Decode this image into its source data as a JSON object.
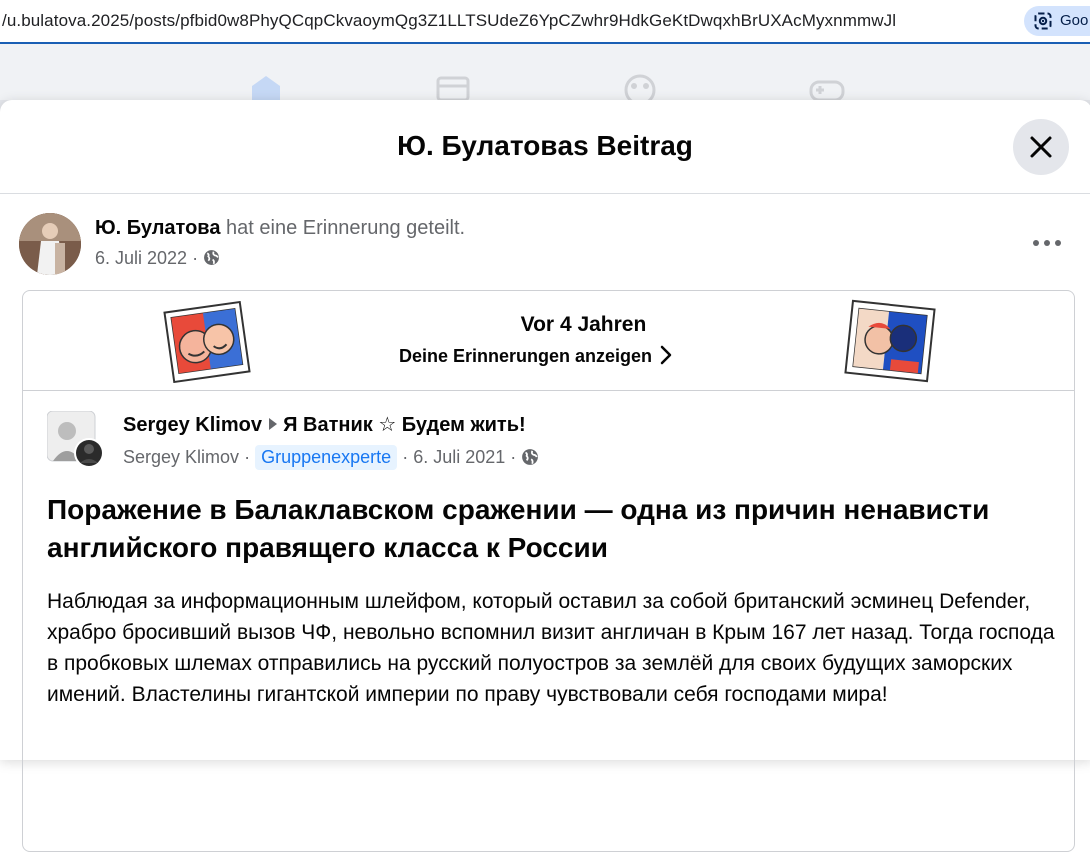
{
  "browser": {
    "url": "/u.bulatova.2025/posts/pfbid0w8PhyQCqpCkvaoymQg3Z1LLTSUdeZ6YpCZwhr9HdkGeKtDwqxhBrUXAcMyxnmmwJl",
    "lens_label": "Goo"
  },
  "modal": {
    "title": "Ю. Булатовas Beitrag"
  },
  "post": {
    "author": "Ю. Булатова",
    "action": "hat eine Erinnerung geteilt.",
    "date": "6. Juli 2022",
    "separator": "·"
  },
  "memory": {
    "title": "Vor 4 Jahren",
    "link": "Deine Erinnerungen anzeigen"
  },
  "shared": {
    "author": "Sergey Klimov",
    "group": "Я Ватник ☆ Будем жить!",
    "sub_author": "Sergey Klimov",
    "badge": "Gruppenexperte",
    "date": "6. Juli 2021",
    "separator": "·",
    "headline": "Поражение в Балаклавском сражении — одна из причин ненависти английского правящего класса к России",
    "body": "Наблюдая за информационным шлейфом, который оставил за собой британский эсминец Defender, храбро бросивший вызов ЧФ, невольно вспомнил визит англичан в Крым 167 лет назад. Тогда господа в пробковых шлемах отправились на русский полуостров за землёй для своих будущих заморских имений. Властелины гигантской империи по праву чувствовали себя господами мира!"
  },
  "icons": {
    "close": "close-icon",
    "more": "more-icon",
    "globe": "globe-icon",
    "chevron": "chevron-right-icon",
    "lens": "lens-icon",
    "group_arrow": "triangle-right-icon"
  },
  "colors": {
    "accent": "#1877f2",
    "secondary_text": "#65676b",
    "badge_bg": "#e7f3ff"
  }
}
